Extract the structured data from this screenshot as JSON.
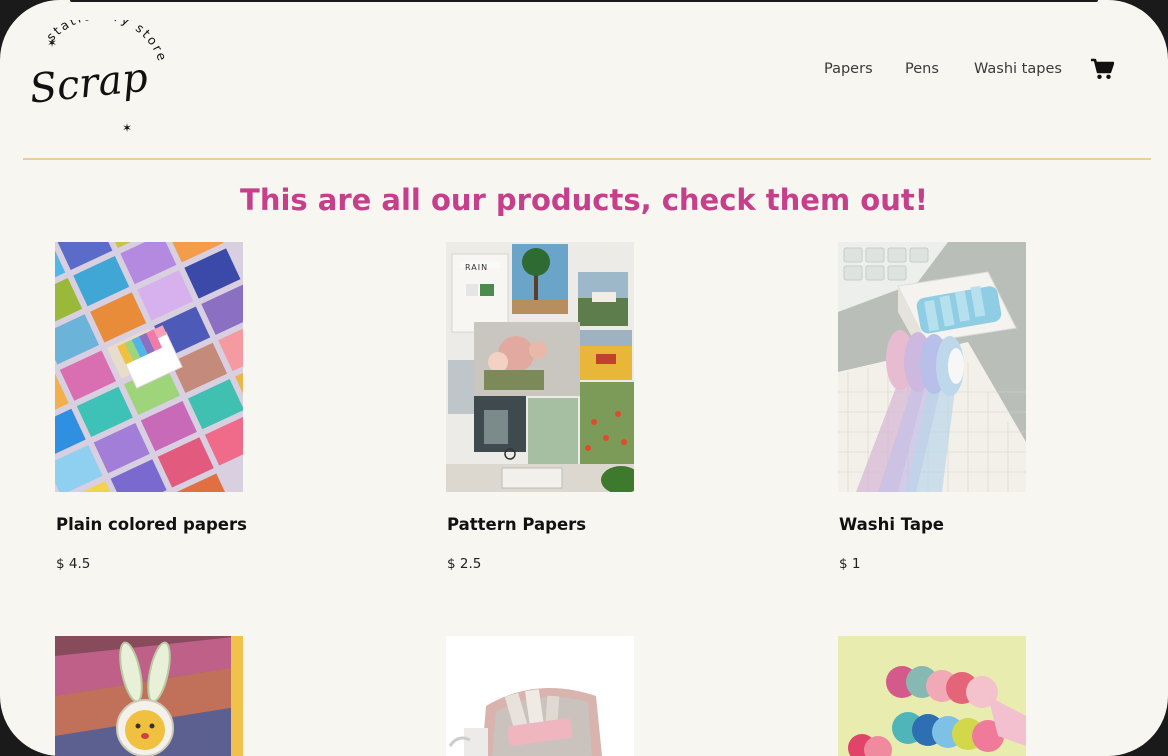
{
  "brand": {
    "logo_script": "Scrap",
    "logo_ring": "stationery store"
  },
  "nav": {
    "items": [
      {
        "label": "Papers"
      },
      {
        "label": "Pens"
      },
      {
        "label": "Washi tapes"
      }
    ],
    "cart_icon": "shopping-cart-icon"
  },
  "main": {
    "headline": "This are all our products, check them out!",
    "products": [
      {
        "name": "Plain colored papers",
        "price": "$ 4.5",
        "image": "colored-papers-image"
      },
      {
        "name": "Pattern Papers",
        "price": "$ 2.5",
        "image": "pattern-papers-image"
      },
      {
        "name": "Washi Tape",
        "price": "$ 1",
        "image": "washi-tape-image"
      },
      {
        "image": "bunny-pen-image"
      },
      {
        "image": "pencil-case-image"
      },
      {
        "image": "washi-tape-set-image"
      }
    ]
  },
  "colors": {
    "background": "#f8f6f1",
    "headline": "#c63f8b",
    "divider": "#eccd9f",
    "nav_text": "#3a3a3a"
  }
}
